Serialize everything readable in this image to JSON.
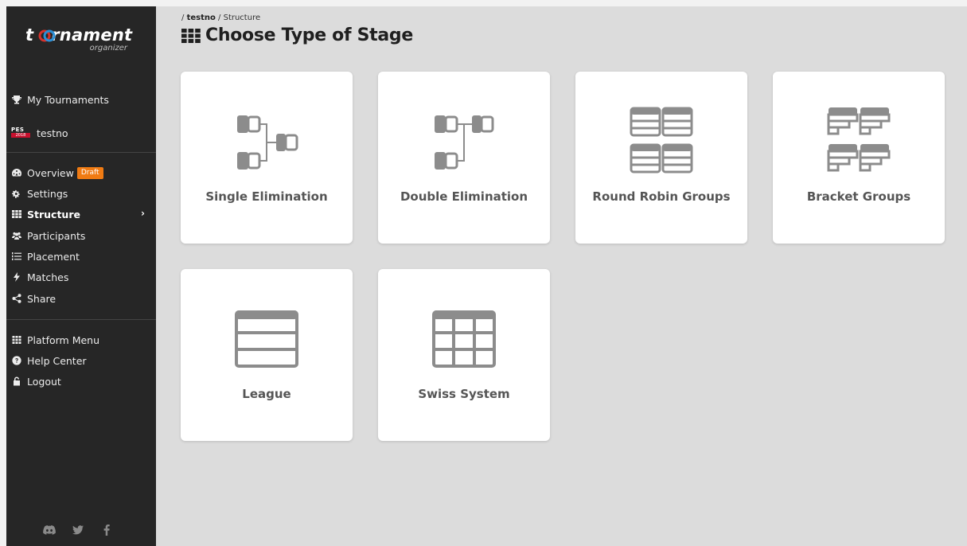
{
  "app": {
    "logo_text": "tournament",
    "logo_sub": "organizer"
  },
  "sidebar": {
    "my_tournaments": "My Tournaments",
    "tournament_name": "testno",
    "game_logo": {
      "top": "PES",
      "bottom": "2018"
    },
    "items": [
      {
        "label": "Overview",
        "badge": "Draft",
        "icon": "tachometer-icon"
      },
      {
        "label": "Settings",
        "icon": "gears-icon"
      },
      {
        "label": "Structure",
        "icon": "grid-icon",
        "active": true
      },
      {
        "label": "Participants",
        "icon": "users-icon"
      },
      {
        "label": "Placement",
        "icon": "list-ol-icon"
      },
      {
        "label": "Matches",
        "icon": "bolt-icon"
      },
      {
        "label": "Share",
        "icon": "share-icon"
      }
    ],
    "platform_items": [
      {
        "label": "Platform Menu",
        "icon": "th-icon"
      },
      {
        "label": "Help Center",
        "icon": "question-circle-icon"
      },
      {
        "label": "Logout",
        "icon": "unlock-icon"
      }
    ],
    "social": [
      "discord-icon",
      "twitter-icon",
      "facebook-icon"
    ]
  },
  "header": {
    "breadcrumb_root": "testno",
    "breadcrumb_current": "Structure",
    "title": "Choose Type of Stage"
  },
  "stage_types": [
    {
      "label": "Single Elimination",
      "icon": "single-elimination-icon"
    },
    {
      "label": "Double Elimination",
      "icon": "double-elimination-icon"
    },
    {
      "label": "Round Robin Groups",
      "icon": "round-robin-groups-icon"
    },
    {
      "label": "Bracket Groups",
      "icon": "bracket-groups-icon"
    },
    {
      "label": "League",
      "icon": "league-icon"
    },
    {
      "label": "Swiss System",
      "icon": "swiss-system-icon"
    }
  ],
  "colors": {
    "sidebar_bg": "#262626",
    "main_bg": "#dcdcdc",
    "badge": "#f07b13",
    "logo_ring_a": "#d6322c",
    "logo_ring_b": "#2b8fd6",
    "icon_gray": "#8c8c8c"
  }
}
